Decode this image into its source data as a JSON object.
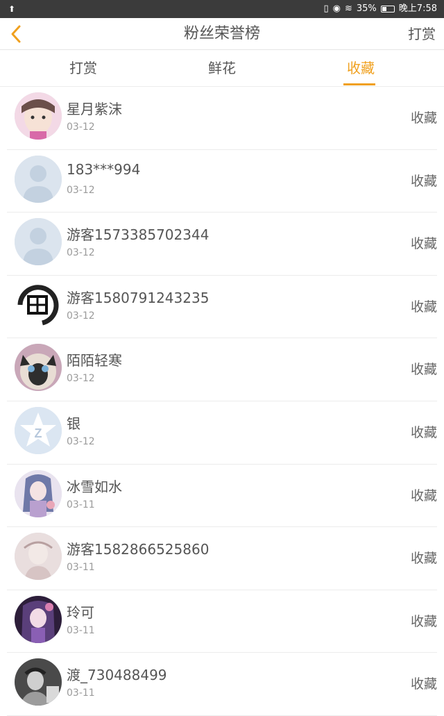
{
  "status_bar": {
    "left_icon": "usb-icon",
    "battery_pct": "35%",
    "time": "晚上7:58"
  },
  "header": {
    "title": "粉丝荣誉榜",
    "right_action": "打赏"
  },
  "tabs": [
    {
      "label": "打赏",
      "active": false
    },
    {
      "label": "鲜花",
      "active": false
    },
    {
      "label": "收藏",
      "active": true
    }
  ],
  "colors": {
    "accent": "#f0a01e",
    "statusbar": "#3b3b3b",
    "text": "#555555",
    "subtext": "#9a9a9a"
  },
  "list": [
    {
      "name": "星月紫沫",
      "date": "03-12",
      "action": "收藏",
      "avatar": "photo-child"
    },
    {
      "name": "183***994",
      "date": "03-12",
      "action": "收藏",
      "avatar": "default-person"
    },
    {
      "name": "游客1573385702344",
      "date": "03-12",
      "action": "收藏",
      "avatar": "default-person"
    },
    {
      "name": "游客1580791243235",
      "date": "03-12",
      "action": "收藏",
      "avatar": "calligraphy"
    },
    {
      "name": "陌陌轻寒",
      "date": "03-12",
      "action": "收藏",
      "avatar": "cat"
    },
    {
      "name": "银",
      "date": "03-12",
      "action": "收藏",
      "avatar": "qq-star"
    },
    {
      "name": "冰雪如水",
      "date": "03-11",
      "action": "收藏",
      "avatar": "anime-girl"
    },
    {
      "name": "游客1582866525860",
      "date": "03-11",
      "action": "收藏",
      "avatar": "sketch"
    },
    {
      "name": "玲可",
      "date": "03-11",
      "action": "收藏",
      "avatar": "anime-purple"
    },
    {
      "name": "渡_730488499",
      "date": "03-11",
      "action": "收藏",
      "avatar": "bw-photo"
    }
  ]
}
